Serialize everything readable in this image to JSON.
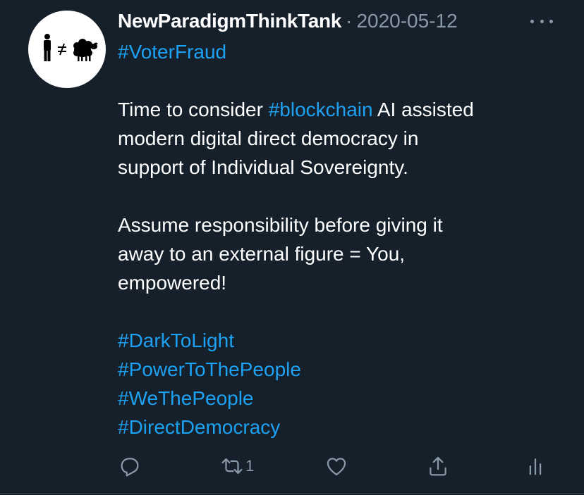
{
  "tweet": {
    "username": "NewParadigmThinkTank",
    "separator": "·",
    "date": "2020-05-12",
    "avatar_icon": "man-not-equal-sheep-icon",
    "lines": {
      "l1": {
        "tag": "#VoterFraud"
      },
      "l2": {
        "pre": "Time to consider ",
        "tag": "#blockchain",
        "post": " AI assisted"
      },
      "l3": "modern digital direct democracy in",
      "l4": "support of Individual Sovereignty.",
      "l5": "Assume responsibility before giving it",
      "l6": "away to an external figure = You,",
      "l7": "empowered!",
      "tags": [
        "#DarkToLight",
        "#PowerToThePeople",
        "#WeThePeople",
        "#DirectDemocracy"
      ]
    },
    "actions": {
      "reply_icon": "reply-icon",
      "retweet_icon": "retweet-icon",
      "retweet_count": "1",
      "like_icon": "heart-icon",
      "share_icon": "share-icon",
      "analytics_icon": "analytics-icon"
    },
    "colors": {
      "background": "#15202b",
      "link": "#1da1f2",
      "muted": "#8899a6",
      "text": "#ffffff"
    }
  }
}
